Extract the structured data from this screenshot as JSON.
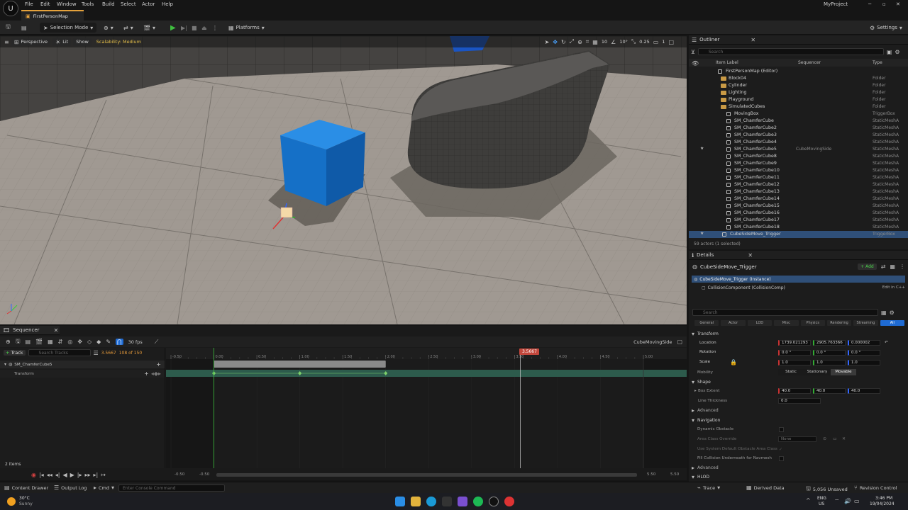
{
  "menu": {
    "items": [
      "File",
      "Edit",
      "Window",
      "Tools",
      "Build",
      "Select",
      "Actor",
      "Help"
    ],
    "project": "MyProject"
  },
  "tab": {
    "label": "FirstPersonMap"
  },
  "toolbar": {
    "mode_label": "Selection Mode",
    "platforms_label": "Platforms",
    "settings_label": "Settings"
  },
  "viewport": {
    "perspective": "Perspective",
    "lit": "Lit",
    "show": "Show",
    "scalability": "Scalability: Medium",
    "grid_snap": "10",
    "rot_snap": "10°",
    "scale_snap": "0.25",
    "cam_speed": "1"
  },
  "outliner": {
    "title": "Outliner",
    "search_placeholder": "Search",
    "col_label": "Item Label",
    "col_sequencer": "Sequencer",
    "col_type": "Type",
    "rows": [
      {
        "label": "FirstPersonMap (Editor)",
        "type": "",
        "seq": ""
      },
      {
        "label": "Block04",
        "type": "Folder",
        "seq": ""
      },
      {
        "label": "Cylinder",
        "type": "Folder",
        "seq": ""
      },
      {
        "label": "Lighting",
        "type": "Folder",
        "seq": ""
      },
      {
        "label": "Playground",
        "type": "Folder",
        "seq": ""
      },
      {
        "label": "SimulatedCubes",
        "type": "Folder",
        "seq": ""
      },
      {
        "label": "MovingBox",
        "type": "TriggerBox",
        "seq": ""
      },
      {
        "label": "SM_ChamferCube",
        "type": "StaticMeshA",
        "seq": ""
      },
      {
        "label": "SM_ChamferCube2",
        "type": "StaticMeshA",
        "seq": ""
      },
      {
        "label": "SM_ChamferCube3",
        "type": "StaticMeshA",
        "seq": ""
      },
      {
        "label": "SM_ChamferCube4",
        "type": "StaticMeshA",
        "seq": ""
      },
      {
        "label": "SM_ChamferCube5",
        "type": "StaticMeshA",
        "seq": "CubeMovingSide"
      },
      {
        "label": "SM_ChamferCube8",
        "type": "StaticMeshA",
        "seq": ""
      },
      {
        "label": "SM_ChamferCube9",
        "type": "StaticMeshA",
        "seq": ""
      },
      {
        "label": "SM_ChamferCube10",
        "type": "StaticMeshA",
        "seq": ""
      },
      {
        "label": "SM_ChamferCube11",
        "type": "StaticMeshA",
        "seq": ""
      },
      {
        "label": "SM_ChamferCube12",
        "type": "StaticMeshA",
        "seq": ""
      },
      {
        "label": "SM_ChamferCube13",
        "type": "StaticMeshA",
        "seq": ""
      },
      {
        "label": "SM_ChamferCube14",
        "type": "StaticMeshA",
        "seq": ""
      },
      {
        "label": "SM_ChamferCube15",
        "type": "StaticMeshA",
        "seq": ""
      },
      {
        "label": "SM_ChamferCube16",
        "type": "StaticMeshA",
        "seq": ""
      },
      {
        "label": "SM_ChamferCube17",
        "type": "StaticMeshA",
        "seq": ""
      },
      {
        "label": "SM_ChamferCube18",
        "type": "StaticMeshA",
        "seq": ""
      },
      {
        "label": "CubeSideMove_Trigger",
        "type": "TriggerBox",
        "seq": ""
      }
    ],
    "footer": "59 actors (1 selected)"
  },
  "details": {
    "title": "Details",
    "actor_name": "CubeSideMove_Trigger",
    "add_label": "+ Add",
    "instance_label": "CubeSideMove_Trigger (Instance)",
    "component_label": "CollisionComponent (CollisionComp)",
    "edit_cpp": "Edit in C++",
    "search_placeholder": "Search",
    "filters": [
      "General",
      "Actor",
      "LOD",
      "Misc",
      "Physics",
      "Rendering",
      "Streaming",
      "All"
    ],
    "transform": {
      "title": "Transform",
      "location_label": "Location",
      "rotation_label": "Rotation",
      "scale_label": "Scale",
      "location": [
        "1739.021293",
        "2905.763366",
        "0.000002"
      ],
      "rotation": [
        "0.0 °",
        "0.0 °",
        "0.0 °"
      ],
      "scale": [
        "1.0",
        "1.0",
        "1.0"
      ],
      "mobility_label": "Mobility",
      "mobility_options": [
        "Static",
        "Stationary",
        "Movable"
      ]
    },
    "shape": {
      "title": "Shape",
      "box_extent_label": "Box Extent",
      "box_extent": [
        "40.0",
        "40.0",
        "40.0"
      ],
      "line_thickness_label": "Line Thickness",
      "line_thickness": "0.0",
      "advanced": "Advanced"
    },
    "navigation": {
      "title": "Navigation",
      "dynamic_obstacle": "Dynamic Obstacle",
      "area_class_override": "Area Class Override",
      "area_value": "None",
      "use_system_default": "Use System Default Obstacle Area Class",
      "fill_collision": "Fill Collision Underneath for Navmesh",
      "advanced": "Advanced"
    },
    "hlod": "HLOD"
  },
  "sequencer": {
    "title": "Sequencer",
    "track_button": "Track",
    "search_placeholder": "Search Tracks",
    "time_value": "3.5667",
    "frame_info": "108 of 150",
    "fps": "30 fps",
    "sequence_name": "CubeMovingSide",
    "playhead_label": "3.5667",
    "tracks": [
      {
        "label": "SM_ChamferCube5"
      },
      {
        "label": "Transform"
      }
    ],
    "ticks": [
      "-0.50",
      "0.00",
      "0.50",
      "1.00",
      "1.50",
      "2.00",
      "2.50",
      "3.00",
      "3.50",
      "4.00",
      "4.50",
      "5.00"
    ],
    "items_count": "2 items",
    "range_start_a": "-0.50",
    "range_start_b": "-0.50",
    "range_end_a": "5.50",
    "range_end_b": "5.50"
  },
  "statusbar": {
    "content_drawer": "Content Drawer",
    "output_log": "Output Log",
    "cmd": "Cmd",
    "console_placeholder": "Enter Console Command",
    "trace": "Trace",
    "derived_data": "Derived Data",
    "unsaved": "5,056 Unsaved",
    "revision": "Revision Control"
  },
  "taskbar": {
    "weather_temp": "30°C",
    "weather_cond": "Sunny",
    "lang": "ENG",
    "region": "US",
    "time": "3:46 PM",
    "date": "19/04/2024"
  }
}
